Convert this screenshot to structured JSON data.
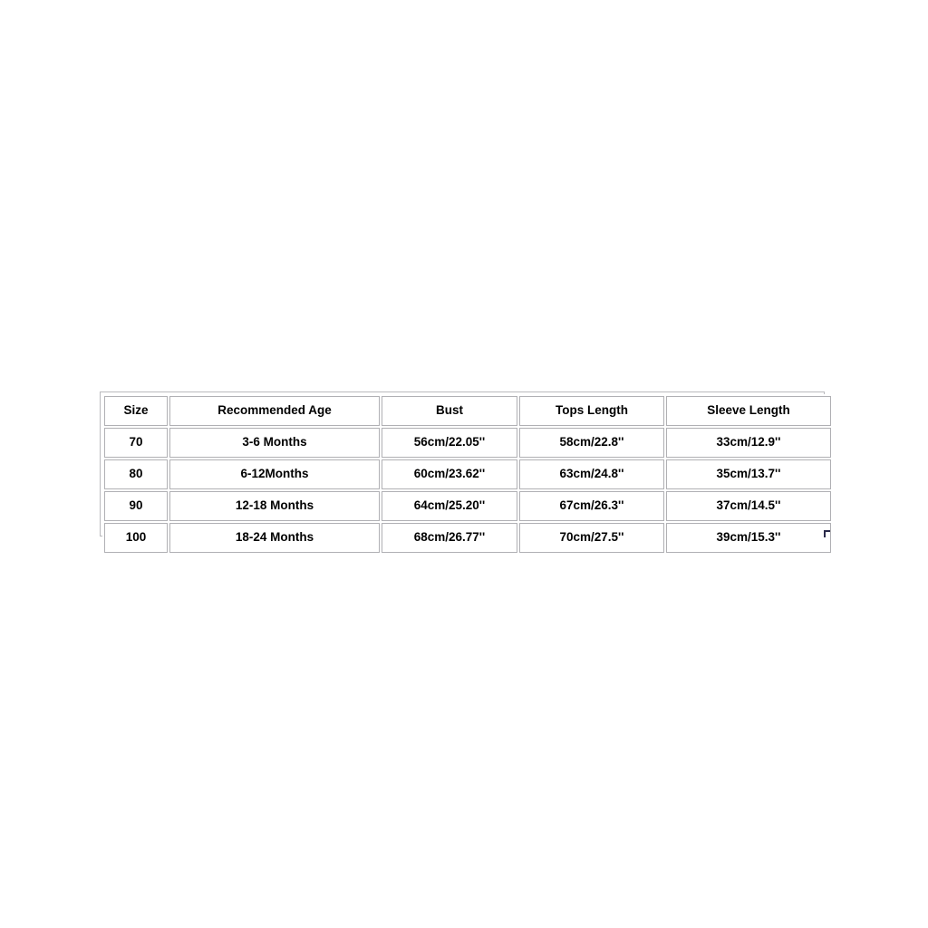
{
  "page": {
    "background_color": "#ffffff",
    "text_color": "#000000",
    "border_color": "#b0b0b4",
    "outer_border_color": "#b9b9bd",
    "corner_mark_color": "#2a2a4a"
  },
  "chart_data": {
    "type": "table",
    "title": "",
    "columns": [
      "Size",
      "Recommended Age",
      "Bust",
      "Tops Length",
      "Sleeve Length"
    ],
    "rows": [
      [
        "70",
        "3-6 Months",
        "56cm/22.05''",
        "58cm/22.8''",
        "33cm/12.9''"
      ],
      [
        "80",
        "6-12Months",
        "60cm/23.62''",
        "63cm/24.8''",
        "35cm/13.7''"
      ],
      [
        "90",
        "12-18 Months",
        "64cm/25.20''",
        "67cm/26.3''",
        "37cm/14.5''"
      ],
      [
        "100",
        "18-24 Months",
        "68cm/26.77''",
        "70cm/27.5''",
        "39cm/15.3''"
      ]
    ]
  },
  "size_chart": {
    "headers": {
      "size": "Size",
      "recommended_age": "Recommended Age",
      "bust": "Bust",
      "tops_length": "Tops Length",
      "sleeve_length": "Sleeve Length"
    },
    "rows": [
      {
        "size": "70",
        "recommended_age": "3-6 Months",
        "bust": "56cm/22.05''",
        "tops_length": "58cm/22.8''",
        "sleeve_length": "33cm/12.9''"
      },
      {
        "size": "80",
        "recommended_age": "6-12Months",
        "bust": "60cm/23.62''",
        "tops_length": "63cm/24.8''",
        "sleeve_length": "35cm/13.7''"
      },
      {
        "size": "90",
        "recommended_age": "12-18 Months",
        "bust": "64cm/25.20''",
        "tops_length": "67cm/26.3''",
        "sleeve_length": "37cm/14.5''"
      },
      {
        "size": "100",
        "recommended_age": "18-24 Months",
        "bust": "68cm/26.77''",
        "tops_length": "70cm/27.5''",
        "sleeve_length": "39cm/15.3''"
      }
    ]
  }
}
